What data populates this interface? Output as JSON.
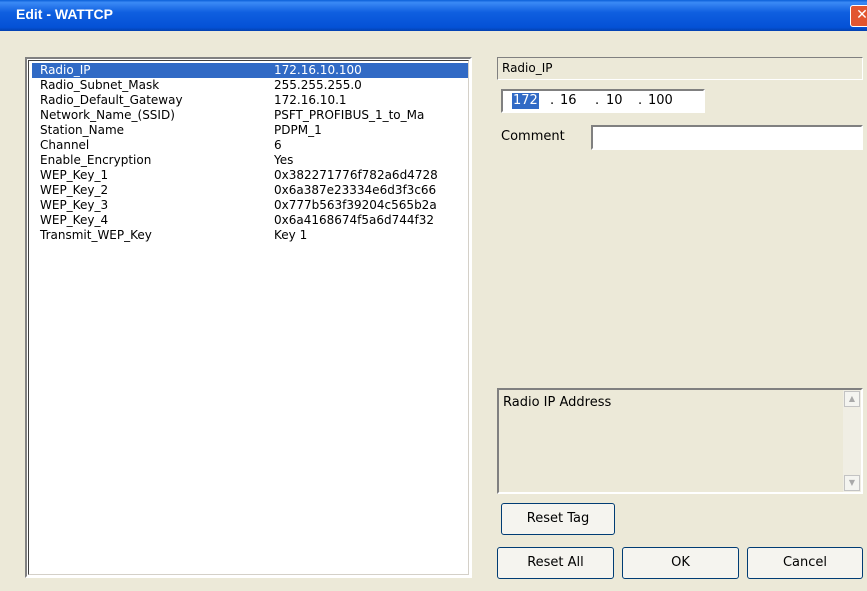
{
  "window": {
    "title": "Edit - WATTCP",
    "close_glyph": "✕"
  },
  "params": [
    {
      "name": "Radio_IP",
      "value": "172.16.10.100",
      "selected": true
    },
    {
      "name": "Radio_Subnet_Mask",
      "value": "255.255.255.0"
    },
    {
      "name": "Radio_Default_Gateway",
      "value": "172.16.10.1"
    },
    {
      "name": "Network_Name_(SSID)",
      "value": "PSFT_PROFIBUS_1_to_Ma"
    },
    {
      "name": "Station_Name",
      "value": "PDPM_1"
    },
    {
      "name": "Channel",
      "value": "6"
    },
    {
      "name": "Enable_Encryption",
      "value": "Yes"
    },
    {
      "name": "WEP_Key_1",
      "value": "0x382271776f782a6d4728"
    },
    {
      "name": "WEP_Key_2",
      "value": "0x6a387e23334e6d3f3c66"
    },
    {
      "name": "WEP_Key_3",
      "value": "0x777b563f39204c565b2a"
    },
    {
      "name": "WEP_Key_4",
      "value": "0x6a4168674f5a6d744f32"
    },
    {
      "name": "Transmit_WEP_Key",
      "value": "Key 1"
    }
  ],
  "editor": {
    "tag_name": "Radio_IP",
    "ip": {
      "o1": "172",
      "o2": "16",
      "o3": "10",
      "o4": "100",
      "sep": "."
    },
    "comment_label": "Comment",
    "comment_value": "",
    "description": "Radio IP Address"
  },
  "buttons": {
    "reset_tag": "Reset Tag",
    "reset_all": "Reset All",
    "ok": "OK",
    "cancel": "Cancel"
  },
  "icons": {
    "scroll_up": "▲",
    "scroll_down": "▼"
  },
  "colors": {
    "selection": "#316ac5",
    "titlebar": "#0451d6",
    "dialog_bg": "#ece9d8"
  }
}
